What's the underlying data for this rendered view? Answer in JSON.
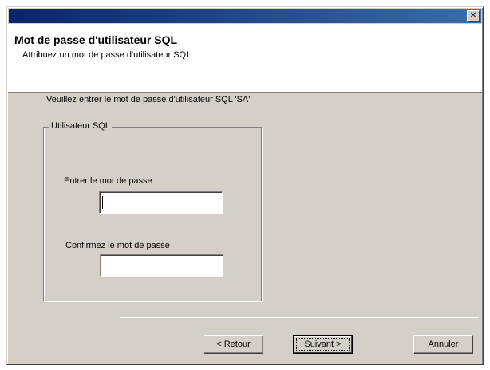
{
  "dialog": {
    "close_glyph": "✕"
  },
  "header": {
    "title": "Mot de passe d'utilisateur SQL",
    "subtitle": "Attribuez un mot de passe d'utilisateur SQL"
  },
  "body": {
    "instruction": "Veuillez entrer le mot de passe d'utilisateur SQL 'SA'",
    "group_label": "Utilisateur SQL",
    "password_label": "Entrer le mot de passe",
    "password_value": "",
    "confirm_label": "Confirmez le mot de passe",
    "confirm_value": ""
  },
  "buttons": {
    "back_prefix": "< ",
    "back_mnemonic": "R",
    "back_rest": "etour",
    "next_mnemonic": "S",
    "next_rest": "uivant >",
    "cancel_mnemonic": "A",
    "cancel_rest": "nnuler"
  },
  "colors": {
    "title_bar_start": "#0a246a",
    "title_bar_end": "#3a6ea5",
    "dialog_face": "#d4d0c8",
    "header_background": "#ffffff"
  }
}
